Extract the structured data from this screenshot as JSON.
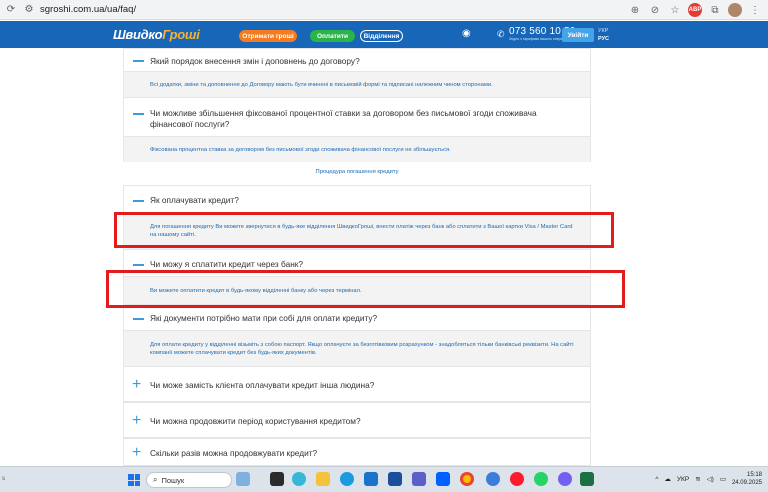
{
  "browser": {
    "url": "sgroshi.com.ua/ua/faq/"
  },
  "header": {
    "logo_main": "Швидко",
    "logo_accent": "Гроші",
    "btn_get_money": "Отримати гроші",
    "btn_pay": "Оплатити",
    "btn_branches": "Відділення",
    "phone": "073 560 10 50",
    "phone_sub": "Згідно з тарифами вашого оператора",
    "login": "Увійти",
    "lang_ukr": "УКР",
    "lang_rus": "РУС"
  },
  "faq": {
    "q1": "Який порядок внесення змін і доповнень до договору?",
    "a1": "Всі додатки, зміни та доповнення до Договору мають бути вчинені в письмовій формі та підписані належним чином сторонами.",
    "q2": "Чи можливе збільшення фіксованої процентної ставки за договором без письмової згоди споживача фінансової послуги?",
    "a2": "Фіксована процентна ставка за договором без письмової згоди споживача фінансової послуги не збільшується.",
    "section_link": "Процедура погашення кредиту",
    "q3": "Як оплачувати кредит?",
    "a3": "Для погашення кредиту Ви можете звернутися в будь-яке відділення ШвидкоГроші, внести платіж через банк або сплатити з Вашої картки Visa / Master Card на нашому сайті.",
    "q4": "Чи можу я сплатити кредит через банк?",
    "a4": "Ви можете оплатити кредит в будь-якому відділенні банку або через термінал.",
    "q5": "Які документи потрібно мати при собі для оплати кредиту?",
    "a5": "Для оплати кредиту у відділенні візьміть з собою паспорт. Якщо оплачуєте за безготівковим розрахунком - знадобляться тільки банківські реквізити. На сайті компанії можете сплачувати кредит без будь-яких документів.",
    "q6": "Чи може замість клієнта оплачувати кредит інша людина?",
    "q7": "Чи можна продовжити період користування кредитом?",
    "q8": "Скільки разів можна продовжувати кредит?"
  },
  "taskbar": {
    "left_text": "s",
    "search_placeholder": "Пошук",
    "lang": "УКР",
    "time": "15:18",
    "date": "24.09.2025"
  },
  "colors": {
    "brand_blue": "#1766b7",
    "accent_orange": "#f47b20",
    "accent_green": "#2cb34a",
    "link_blue": "#1c6bb5",
    "highlight_red": "#e51b1b"
  }
}
